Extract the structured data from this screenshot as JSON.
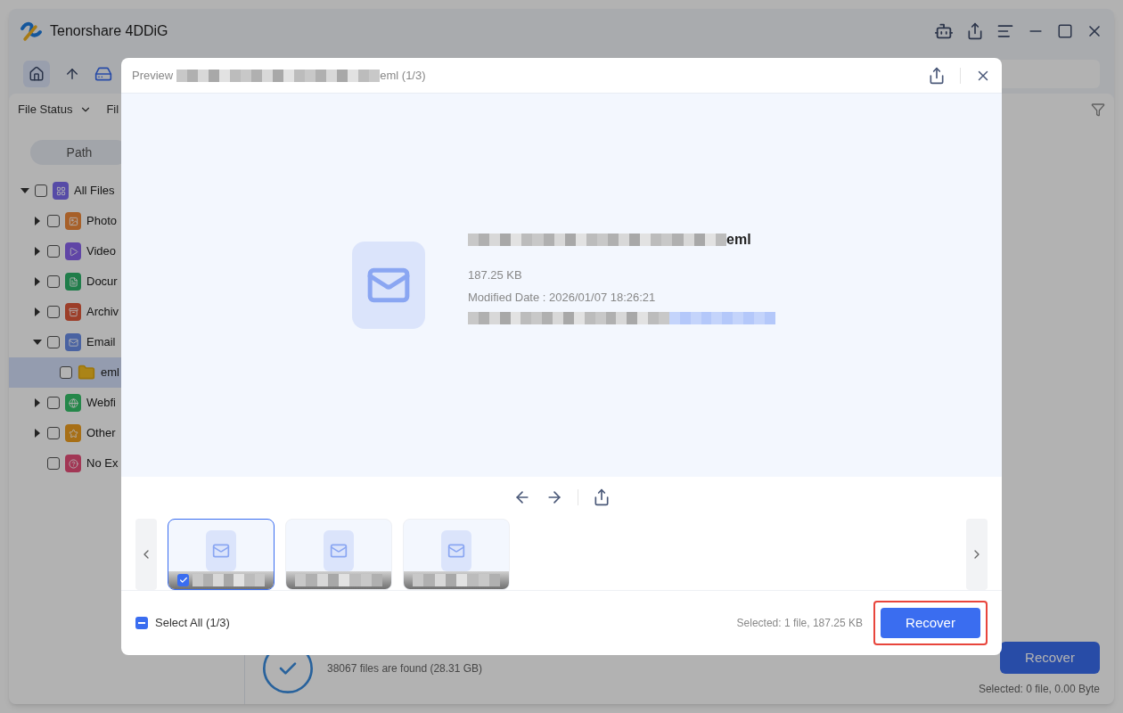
{
  "app": {
    "title": "Tenorshare 4DDiG"
  },
  "filter_bar": {
    "items": [
      "File Status",
      "Fil"
    ]
  },
  "sidebar": {
    "tab": "Path",
    "tree": [
      {
        "label": "All Files",
        "kind": "all",
        "checked": false,
        "expanded": true,
        "selected": false,
        "children": [
          {
            "label": "Photo",
            "kind": "photo",
            "checked": false,
            "expanded": false,
            "selected": false
          },
          {
            "label": "Video",
            "kind": "video",
            "checked": false,
            "expanded": false,
            "selected": false
          },
          {
            "label": "Docur",
            "kind": "document",
            "checked": false,
            "expanded": false,
            "selected": false
          },
          {
            "label": "Archiv",
            "kind": "archive",
            "checked": false,
            "expanded": false,
            "selected": false
          },
          {
            "label": "Email",
            "kind": "email",
            "checked": false,
            "expanded": true,
            "selected": false,
            "children": [
              {
                "label": "eml",
                "kind": "folder",
                "checked": false,
                "selected": true
              }
            ]
          },
          {
            "label": "Webfi",
            "kind": "web",
            "checked": false,
            "expanded": false,
            "selected": false
          },
          {
            "label": "Other",
            "kind": "other",
            "checked": false,
            "expanded": false,
            "selected": false
          },
          {
            "label": "No Ex",
            "kind": "unknown",
            "checked": false,
            "selected": false
          }
        ]
      }
    ]
  },
  "scan_status": {
    "detail": "38067 files are found (28.31 GB)",
    "button": "Recover",
    "selection": "Selected: 0 file, 0.00 Byte"
  },
  "preview_dialog": {
    "title": "Preview",
    "title_suffix": "eml (1/3)",
    "file": {
      "name_suffix": "eml",
      "size": "187.25 KB",
      "modified": "Modified Date : 2026/01/07 18:26:21"
    },
    "thumbnails": [
      {
        "selected": true,
        "checked": true
      },
      {
        "selected": false
      },
      {
        "selected": false
      }
    ],
    "select_all": {
      "label": "Select All (1/3)",
      "indeterminate": true
    },
    "selection": "Selected: 1 file, 187.25 KB",
    "button": "Recover",
    "button_highlighted": true
  }
}
